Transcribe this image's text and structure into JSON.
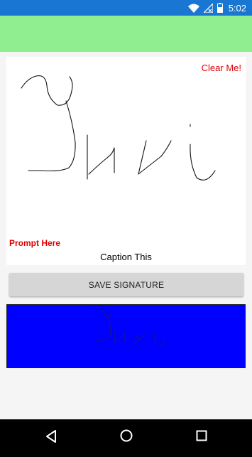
{
  "status_bar": {
    "time": "5:02",
    "icons": [
      "wifi-icon",
      "no-signal-icon",
      "battery-icon"
    ]
  },
  "colors": {
    "status_bar": "#1976d2",
    "header_band": "#90ee90",
    "preview_background": "#0000ff",
    "accent_red": "#e00000"
  },
  "signature_pad": {
    "clear_label": "Clear Me!",
    "prompt_label": "Prompt Here",
    "caption_label": "Caption This"
  },
  "save_button": {
    "label": "SAVE SIGNATURE"
  },
  "nav_bar": {
    "icons": [
      "back-icon",
      "home-icon",
      "recents-icon"
    ]
  }
}
